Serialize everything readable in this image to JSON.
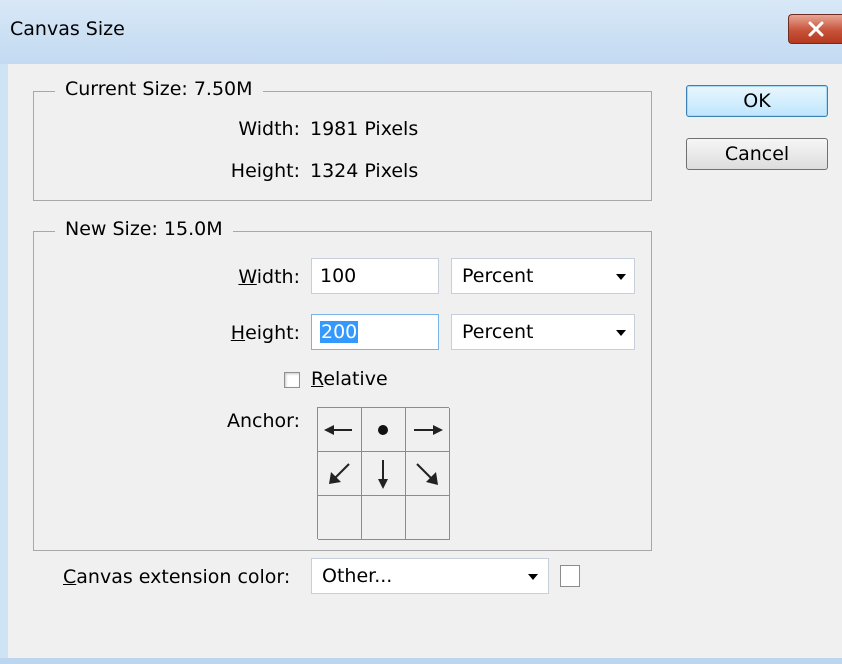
{
  "window": {
    "title": "Canvas Size"
  },
  "current_size": {
    "legend": "Current Size: 7.50M",
    "width_label": "Width:",
    "width_value": "1981 Pixels",
    "height_label": "Height:",
    "height_value": "1324 Pixels"
  },
  "new_size": {
    "legend": "New Size: 15.0M",
    "width_label_accel": "W",
    "width_label_rest": "idth:",
    "width_value": "100",
    "width_unit": "Percent",
    "height_label_accel": "H",
    "height_label_rest": "eight:",
    "height_value": "200",
    "height_unit": "Percent",
    "relative_label_accel": "R",
    "relative_label_rest": "elative",
    "relative_checked": false,
    "anchor_label": "Anchor:",
    "anchor_cells": [
      "arrow-left-icon",
      "anchor-dot-icon",
      "arrow-right-icon",
      "arrow-down-left-icon",
      "arrow-down-icon",
      "arrow-down-right-icon",
      "empty",
      "empty",
      "empty"
    ]
  },
  "extension": {
    "label_accel": "C",
    "label_rest": "anvas extension color:",
    "value": "Other...",
    "swatch_color": "#ffffff"
  },
  "buttons": {
    "ok": "OK",
    "cancel": "Cancel"
  }
}
